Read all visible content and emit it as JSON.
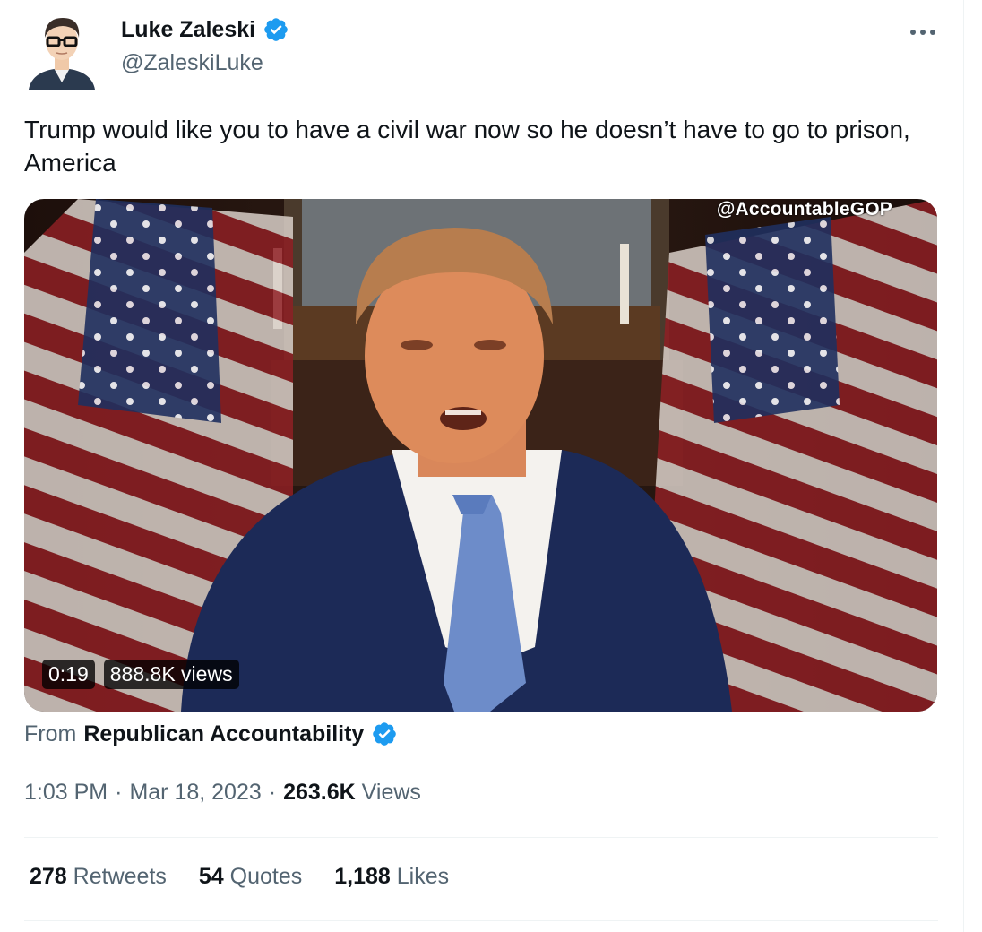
{
  "author": {
    "display_name": "Luke Zaleski",
    "handle": "@ZaleskiLuke",
    "verified_icon": "verified-badge-icon",
    "more_icon": "more-options-icon"
  },
  "tweet": {
    "text": "Trump would like you to have a civil war now so he doesn’t have to go to prison, America"
  },
  "media": {
    "watermark": "@AccountableGOP",
    "duration": "0:19",
    "views": "888.8K views"
  },
  "attribution": {
    "from_label": "From",
    "source": "Republican Accountability"
  },
  "meta": {
    "time": "1:03 PM",
    "separator": "·",
    "date": "Mar 18, 2023",
    "separator2": "·",
    "views_count": "263.6K",
    "views_label": "Views"
  },
  "stats": [
    {
      "count": "278",
      "label": "Retweets"
    },
    {
      "count": "54",
      "label": "Quotes"
    },
    {
      "count": "1,188",
      "label": "Likes"
    }
  ],
  "colors": {
    "verified_blue": "#1d9bf0",
    "text_primary": "#0f1419",
    "text_secondary": "#536471",
    "divider": "#eff3f4"
  }
}
